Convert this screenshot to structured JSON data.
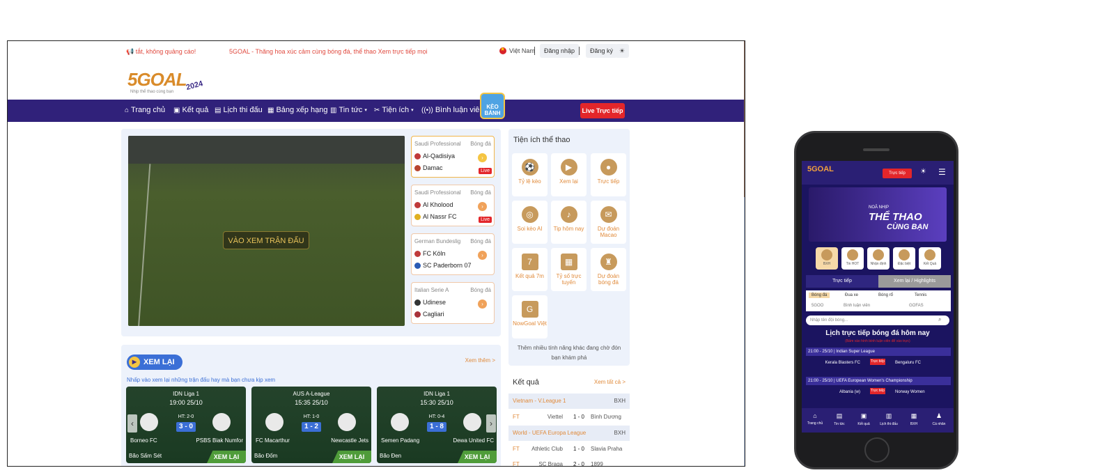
{
  "topbar": {
    "promo_left": "📢 tắt, không quảng cáo!",
    "promo_right": "5GOAL - Thăng hoa xúc cảm cùng bóng đá, thể thao   Xem trực tiếp mọi",
    "language": "Việt Nam",
    "login": "Đăng nhập",
    "register": "Đăng ký",
    "theme_icon": "☀"
  },
  "logo": {
    "word": "5GOAL",
    "year": "2024",
    "tagline": "Nhịp thể thao cùng bạn"
  },
  "nav": {
    "items": [
      "Trang chủ",
      "Kết quả",
      "Lịch thi đấu",
      "Bảng xếp hạng",
      "Tin tức",
      "Tiện ích",
      "Bình luận viên"
    ],
    "icons": [
      "⌂",
      "▣",
      "▤",
      "▦",
      "▥",
      "✂",
      "((•))"
    ],
    "badge": "KÈO BÁNH",
    "live": "Live Trực tiếp"
  },
  "video": {
    "cta": "VÀO XEM TRẬN ĐẤU"
  },
  "matches": [
    {
      "league": "Saudi Professional",
      "sport": "Bóng đá",
      "home": "Al-Qadisiya",
      "away": "Damac",
      "live": "Live"
    },
    {
      "league": "Saudi Professional",
      "sport": "Bóng đá",
      "home": "Al Kholood",
      "away": "Al Nassr FC",
      "live": "Live"
    },
    {
      "league": "German Bundeslig",
      "sport": "Bóng đá",
      "home": "FC Köln",
      "away": "SC Paderborn 07",
      "live": ""
    },
    {
      "league": "Italian Serie A",
      "sport": "Bóng đá",
      "home": "Udinese",
      "away": "Cagliari",
      "live": ""
    }
  ],
  "utilities": {
    "title": "Tiện ích thể thao",
    "tiles": [
      "Tỷ lệ kèo",
      "Xem lại",
      "Trực tiếp",
      "Soi kèo AI",
      "Tip hôm nay",
      "Dự đoán Macao",
      "Kết quả 7m",
      "Tỷ số trực tuyến",
      "Dự đoán bóng đá",
      "NowGoal Việt"
    ],
    "more": "Thêm nhiều tính năng khác đang chờ đón bạn khám phá"
  },
  "results": {
    "title": "Kết quả",
    "all": "Xem tất cả >",
    "rows": [
      {
        "league": "Vietnam - V.League 1",
        "bxh": "BXH",
        "status": "FT",
        "home": "Viettel",
        "score": "1 - 0",
        "away": "Bình Dương"
      },
      {
        "league": "World - UEFA Europa League",
        "bxh": "BXH",
        "status": "FT",
        "home": "Athletic Club",
        "score": "1 - 0",
        "away": "Slavia Praha"
      },
      {
        "league": "",
        "bxh": "",
        "status": "FT",
        "home": "SC Braga",
        "score": "2 - 0",
        "away": "1899"
      }
    ]
  },
  "replay": {
    "badge": "XEM LẠI",
    "more": "Xem thêm >",
    "hint": "Nhấp vào xem lại những trận đấu hay mà bạn chưa kịp xem",
    "cards": [
      {
        "league": "IDN Liga 1",
        "time": "19:00 25/10",
        "ht": "HT: 2-0",
        "score": "3 - 0",
        "home": "Borneo FC",
        "away": "PSBS Biak Numfor",
        "source": "Bão Sấm Sét",
        "cta": "XEM LẠI"
      },
      {
        "league": "AUS A-League",
        "time": "15:35 25/10",
        "ht": "HT: 1-0",
        "score": "1 - 2",
        "home": "FC Macarthur",
        "away": "Newcastle Jets",
        "source": "Bão Đốm",
        "cta": "XEM LẠI"
      },
      {
        "league": "IDN Liga 1",
        "time": "15:30 25/10",
        "ht": "HT: 0-4",
        "score": "1 - 8",
        "home": "Semen Padang",
        "away": "Dewa United FC",
        "source": "Bão Đen",
        "cta": "XEM LẠI"
      }
    ]
  },
  "phone": {
    "logo": "5GOAL",
    "live": "Trực tiếp",
    "banner_sub": "NOÃ NHỊP",
    "banner_main": "THỂ THAO",
    "banner_main2": "CÙNG BẠN",
    "quick": [
      "BXH",
      "Tin HOT",
      "Nhận định",
      "Đặc biệt",
      "Kết Quả"
    ],
    "tab_live": "Trực tiếp",
    "tab_replay": "Xem lại / Highlights",
    "filters": [
      "Bóng đá",
      "Đua xe",
      "Bóng rổ",
      "Tennis",
      "5GOO",
      "Bình luận viên",
      "GOFAS"
    ],
    "search_placeholder": "Nhập tên đội bóng...",
    "title": "Lịch trực tiếp bóng đá hôm nay",
    "subtitle": "(Bấm vào hình bình luận viên để vào trực)",
    "leagues": [
      {
        "time": "21:00 - 25/10 | Indian Super League",
        "home": "Kerala Blasters FC",
        "away": "Bengaluru FC",
        "live": "Trực tiếp"
      },
      {
        "time": "21:00 - 25/10 | UEFA European Women's Championship",
        "home": "Albania (w)",
        "away": "Norway Women",
        "live": "Trực tiếp"
      }
    ],
    "bottom": [
      "Trang chủ",
      "Tin tức",
      "Kết quả",
      "Lịch thi đấu",
      "BXH",
      "Cá nhân"
    ]
  }
}
